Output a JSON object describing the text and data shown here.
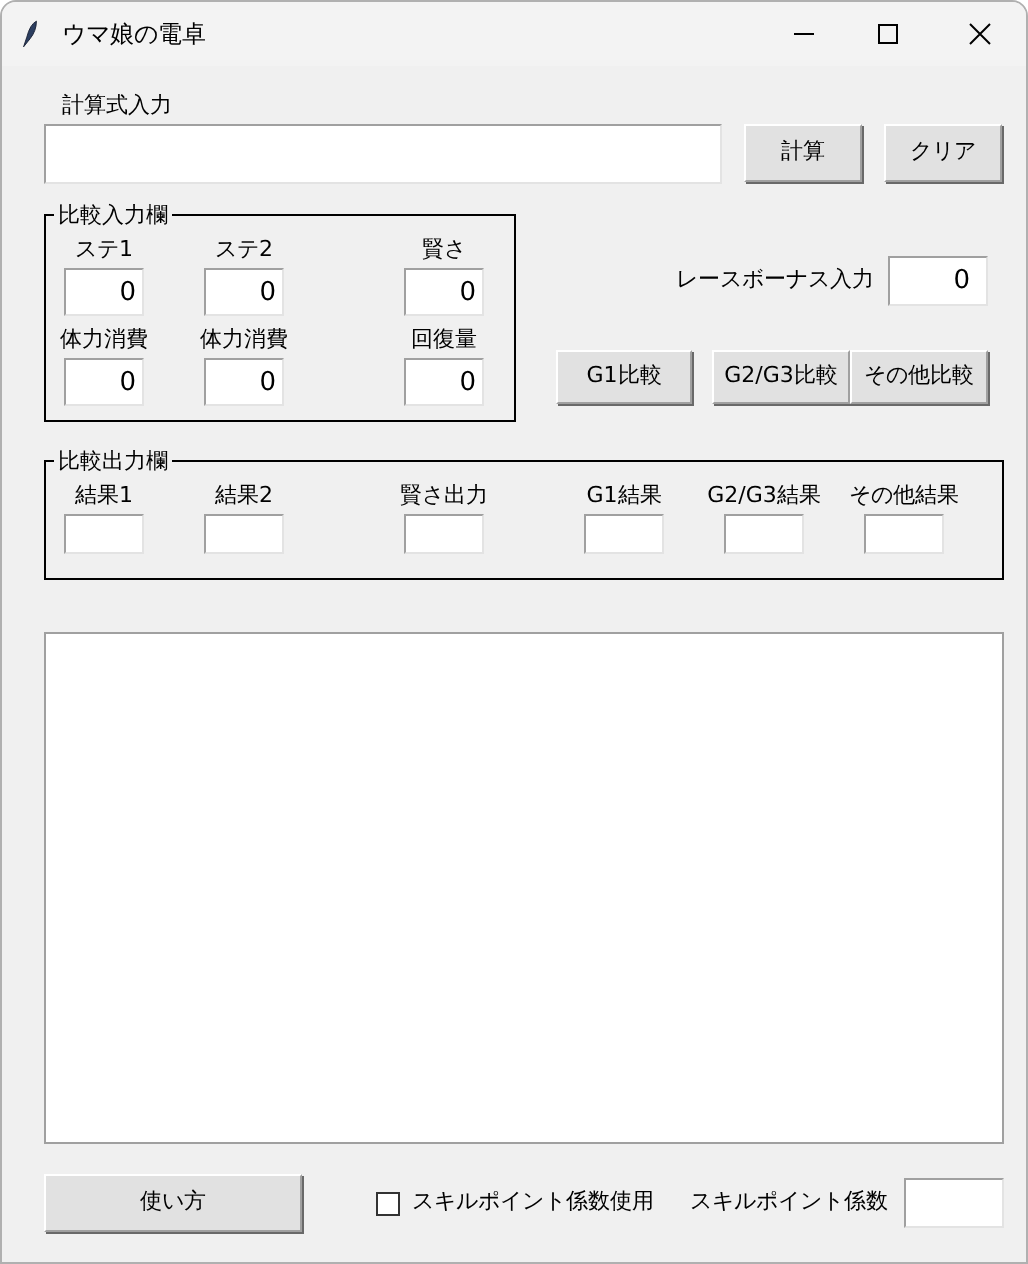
{
  "window": {
    "title": "ウマ娘の電卓"
  },
  "formula": {
    "label": "計算式入力"
  },
  "formula_buttons": [
    "計算",
    "クリア"
  ],
  "compare_input": {
    "title": "比較入力欄",
    "fields": [
      {
        "label": "ステ1",
        "value": "0"
      },
      {
        "label": "ステ2",
        "value": "0"
      },
      {
        "label": "賢さ",
        "value": "0"
      },
      {
        "label": "体力消費",
        "value": "0"
      },
      {
        "label": "体力消費",
        "value": "0"
      },
      {
        "label": "回復量",
        "value": "0"
      }
    ]
  },
  "race_bonus": {
    "label": "レースボーナス入力",
    "value": "0"
  },
  "compare_buttons": [
    "G1比較",
    "G2/G3比較",
    "その他比較"
  ],
  "compare_output": {
    "title": "比較出力欄",
    "fields": [
      {
        "label": "結果1"
      },
      {
        "label": "結果2"
      },
      {
        "label": "賢さ出力"
      },
      {
        "label": "G1結果"
      },
      {
        "label": "G2/G3結果"
      },
      {
        "label": "その他結果"
      }
    ]
  },
  "footer": {
    "help_button": "使い方",
    "checkbox": {
      "label": "スキルポイント係数使用",
      "checked": false
    },
    "coefficient_label": "スキルポイント係数"
  }
}
